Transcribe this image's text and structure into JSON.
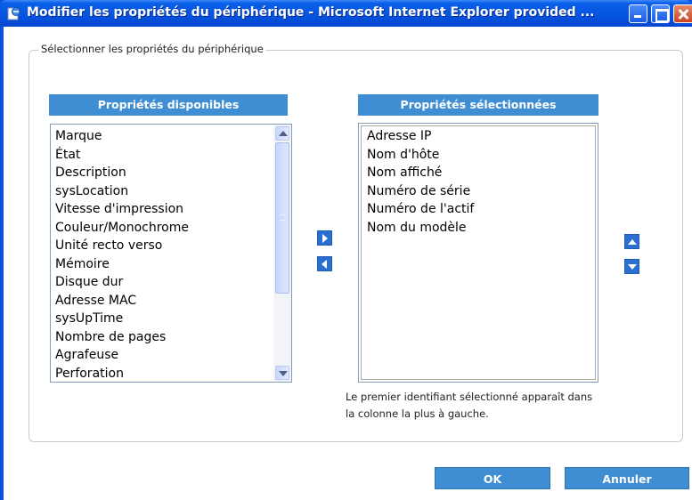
{
  "window": {
    "title": "Modifier les propriétés du périphérique - Microsoft Internet Explorer provided ..."
  },
  "group": {
    "legend": "Sélectionner les propriétés du périphérique"
  },
  "available": {
    "header": "Propriétés disponibles",
    "items": [
      "Marque",
      "État",
      "Description",
      "sysLocation",
      "Vitesse d'impression",
      "Couleur/Monochrome",
      "Unité recto verso",
      "Mémoire",
      "Disque dur",
      "Adresse MAC",
      "sysUpTime",
      "Nombre de pages",
      "Agrafeuse",
      "Perforation"
    ]
  },
  "selected": {
    "header": "Propriétés sélectionnées",
    "items": [
      "Adresse IP",
      "Nom d'hôte",
      "Nom affiché",
      "Numéro de série",
      "Numéro de l'actif",
      "Nom du modèle"
    ],
    "note": "Le premier identifiant sélectionné apparaît dans la colonne la plus à gauche."
  },
  "buttons": {
    "ok": "OK",
    "cancel": "Annuler"
  },
  "icons": {
    "title": "ie-page-icon",
    "add": "arrow-right-icon",
    "remove": "arrow-left-icon",
    "move_up": "arrow-up-icon",
    "move_down": "arrow-down-icon"
  },
  "colors": {
    "titlebar": "#0655e0",
    "header_blue": "#3f8ed4",
    "button_blue": "#2a6fd0"
  }
}
